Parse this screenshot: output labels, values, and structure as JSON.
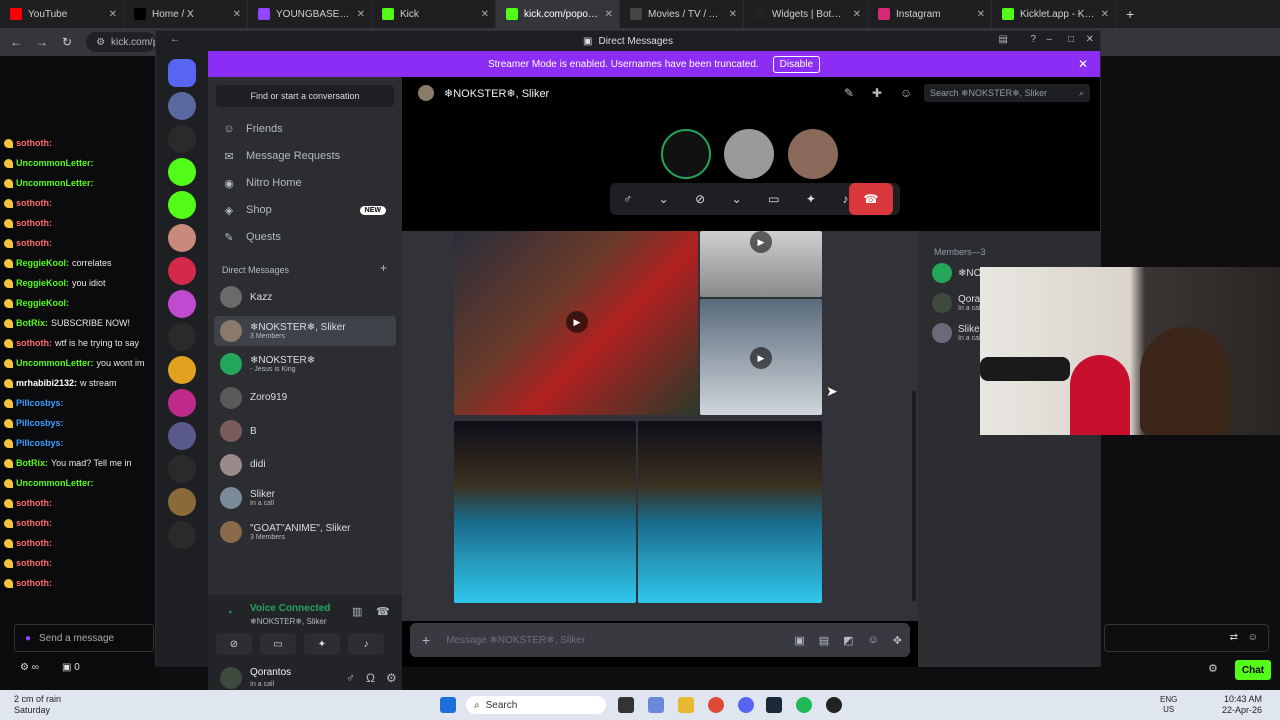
{
  "browser": {
    "tabs": [
      {
        "title": "YouTube",
        "color": "#ff0000"
      },
      {
        "title": "Home / X",
        "color": "#000000"
      },
      {
        "title": "YOUNGBASEDGO - T",
        "color": "#9146ff"
      },
      {
        "title": "Kick",
        "color": "#53fc18"
      },
      {
        "title": "kick.com/popout/qo",
        "color": "#53fc18",
        "active": true
      },
      {
        "title": "Movies / TV / Anime",
        "color": "#444444"
      },
      {
        "title": "Widgets | BotRix — C",
        "color": "#222222"
      },
      {
        "title": "Instagram",
        "color": "#d62976"
      },
      {
        "title": "Kicklet.app - Kick Ch",
        "color": "#53fc18"
      }
    ],
    "url": "kick.com/po"
  },
  "kick_chat": {
    "messages": [
      {
        "user": "sothoth:",
        "text": "",
        "color": "#ff6b6b"
      },
      {
        "user": "UncommonLetter:",
        "text": "",
        "color": "#53fc18"
      },
      {
        "user": "UncommonLetter:",
        "text": "",
        "color": "#53fc18"
      },
      {
        "user": "sothoth:",
        "text": "",
        "color": "#ff6b6b"
      },
      {
        "user": "sothoth:",
        "text": "",
        "color": "#ff6b6b"
      },
      {
        "user": "sothoth:",
        "text": "",
        "color": "#ff6b6b"
      },
      {
        "user": "ReggieKool:",
        "text": "correlates",
        "color": "#53fc18"
      },
      {
        "user": "ReggieKool:",
        "text": "you idiot",
        "color": "#53fc18"
      },
      {
        "user": "ReggieKool:",
        "text": "",
        "color": "#53fc18"
      },
      {
        "user": "BotRix:",
        "text": "SUBSCRIBE NOW!",
        "color": "#53fc18"
      },
      {
        "user": "sothoth:",
        "text": "wtf is he trying to say",
        "color": "#ff6b6b"
      },
      {
        "user": "UncommonLetter:",
        "text": "you wont im",
        "color": "#53fc18"
      },
      {
        "user": "mrhabibi2132:",
        "text": "w stream",
        "color": "#ffffff"
      },
      {
        "user": "Pillcosbys:",
        "text": "",
        "color": "#3aa0ff"
      },
      {
        "user": "Pillcosbys:",
        "text": "",
        "color": "#3aa0ff"
      },
      {
        "user": "Pillcosbys:",
        "text": "",
        "color": "#3aa0ff"
      },
      {
        "user": "BotRix:",
        "text": "You mad? Tell me in",
        "color": "#53fc18"
      },
      {
        "user": "UncommonLetter:",
        "text": "",
        "color": "#53fc18"
      },
      {
        "user": "sothoth:",
        "text": "",
        "color": "#ff6b6b"
      },
      {
        "user": "sothoth:",
        "text": "",
        "color": "#ff6b6b"
      },
      {
        "user": "sothoth:",
        "text": "",
        "color": "#ff6b6b"
      },
      {
        "user": "sothoth:",
        "text": "",
        "color": "#ff6b6b"
      },
      {
        "user": "sothoth:",
        "text": "",
        "color": "#ff6b6b"
      }
    ],
    "input_placeholder": "Send a message",
    "counter": "0",
    "chat_button": "Chat"
  },
  "discord": {
    "window_title": "Direct Messages",
    "streamer_banner": "Streamer Mode is enabled. Usernames have been truncated.",
    "disable_label": "Disable",
    "find_conversation": "Find or start a conversation",
    "nav": [
      {
        "label": "Friends",
        "icon": "friends-icon"
      },
      {
        "label": "Message Requests",
        "icon": "mail-icon"
      },
      {
        "label": "Nitro Home",
        "icon": "nitro-icon"
      },
      {
        "label": "Shop",
        "icon": "shop-icon",
        "badge": "NEW"
      },
      {
        "label": "Quests",
        "icon": "quests-icon"
      }
    ],
    "dm_header": "Direct Messages",
    "dms": [
      {
        "name": "Kazz",
        "sub": ""
      },
      {
        "name": "❄NOKSTER❄, Sliker",
        "sub": "3 Members",
        "selected": true
      },
      {
        "name": "❄NOKSTER❄",
        "sub": "- Jesus is King"
      },
      {
        "name": "Zoro919",
        "sub": ""
      },
      {
        "name": "B",
        "sub": ""
      },
      {
        "name": "didi",
        "sub": ""
      },
      {
        "name": "Sliker",
        "sub": "In a call"
      },
      {
        "name": "\"GOAT\"ANIME\", Sliker",
        "sub": "3 Members"
      }
    ],
    "voice": {
      "title": "Voice Connected",
      "channel": "❄NOKSTER❄, Sliker"
    },
    "user": {
      "name": "Qorantos",
      "status": "In a call"
    },
    "channel": {
      "title": "❄NOKSTER❄, Sliker",
      "search_placeholder": "Search ❄NOKSTER❄, Sliker",
      "composer_placeholder": "Message ❄NOKSTER❄, Sliker"
    },
    "members_header": "Members—3",
    "members": [
      {
        "name": "❄NOKSTER❄",
        "sub": ""
      },
      {
        "name": "Qorantos",
        "sub": "In a call"
      },
      {
        "name": "Sliker",
        "sub": "In a call"
      }
    ]
  },
  "taskbar": {
    "weather_line1": "2 cm of rain",
    "weather_line2": "Saturday",
    "search": "Search",
    "lang1": "ENG",
    "lang2": "US",
    "time": "10:43 AM",
    "date": "22-Apr-26"
  }
}
